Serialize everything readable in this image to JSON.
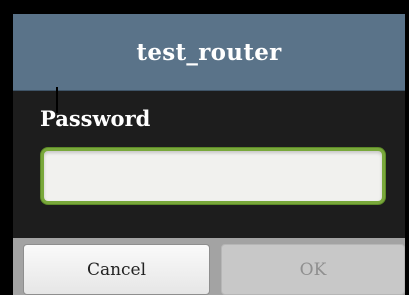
{
  "dialog": {
    "title": "test_router",
    "password_label": "Password",
    "password_value": "",
    "buttons": {
      "cancel_label": "Cancel",
      "ok_label": "OK",
      "ok_enabled": false
    }
  },
  "colors": {
    "title_bar": "#5a7389",
    "dialog_body": "#1d1d1d",
    "input_focus_border": "#79a83b",
    "button_bar": "#a3a3a3"
  }
}
